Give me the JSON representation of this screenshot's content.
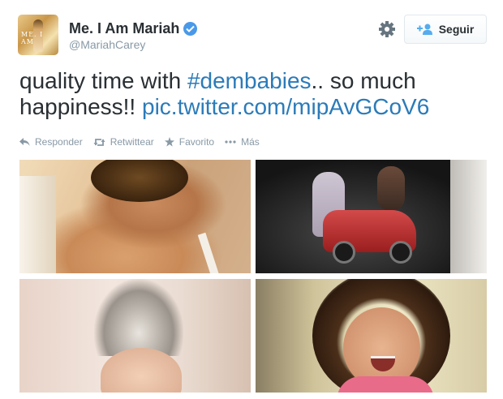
{
  "user": {
    "display_name": "Me. I Am Mariah",
    "handle": "@MariahCarey",
    "verified": true,
    "avatar_text": "ME. I AM"
  },
  "follow_button": {
    "label": "Seguir",
    "icon": "add-user-icon"
  },
  "settings_icon": "gear-icon",
  "tweet": {
    "text": "quality time with ",
    "hashtag": "#dembabies",
    "text_after": ".. so much happiness!! ",
    "link": "pic.twitter.com/mipAvGCoV6"
  },
  "actions": {
    "reply": "Responder",
    "retweet": "Retwittear",
    "favorite": "Favorito",
    "more": "Más"
  },
  "colors": {
    "link": "#2b7bb9",
    "verified": "#4a99e9",
    "muted": "#8899a6"
  }
}
